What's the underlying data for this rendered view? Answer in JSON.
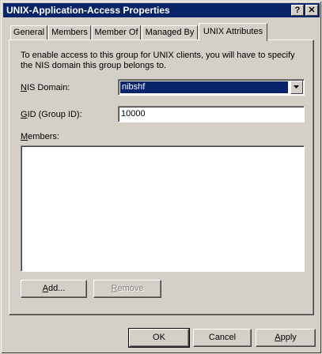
{
  "window": {
    "title": "UNIX-Application-Access Properties",
    "help_glyph": "?",
    "close_glyph": "✕"
  },
  "tabs": [
    {
      "label": "General",
      "active": false
    },
    {
      "label": "Members",
      "active": false
    },
    {
      "label": "Member Of",
      "active": false
    },
    {
      "label": "Managed By",
      "active": false
    },
    {
      "label": "UNIX Attributes",
      "active": true
    }
  ],
  "unix": {
    "description": "To enable access to this group for UNIX clients, you will have to specify the NIS domain this group belongs to.",
    "nis_domain_label_hotkey": "N",
    "nis_domain_label_rest": "IS Domain:",
    "nis_domain_value": "nibshf",
    "gid_label_hotkey": "G",
    "gid_label_rest": "ID (Group ID):",
    "gid_value": "10000",
    "members_label_hotkey": "M",
    "members_label_rest": "embers:",
    "members": [],
    "add_button_hotkey": "A",
    "add_button_rest": "dd...",
    "remove_button_hotkey": "R",
    "remove_button_rest": "emove"
  },
  "footer": {
    "ok": "OK",
    "cancel": "Cancel",
    "apply_hotkey": "A",
    "apply_rest": "pply"
  },
  "colors": {
    "titlebar": "#0a246a",
    "face": "#d4d0c8",
    "selection": "#0a246a"
  }
}
